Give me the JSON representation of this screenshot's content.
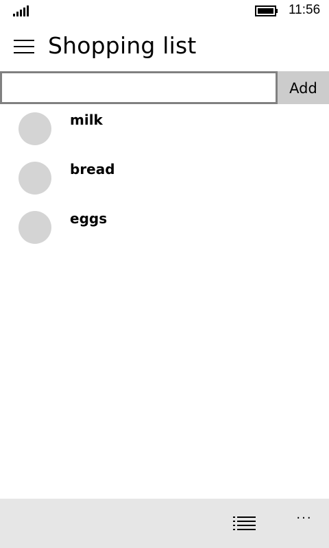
{
  "status_bar": {
    "time": "11:56",
    "signal_icon": "signal-strength-icon",
    "battery_icon": "battery-icon"
  },
  "header": {
    "menu_icon": "hamburger-menu-icon",
    "title": "Shopping list"
  },
  "new_item": {
    "value": "",
    "placeholder": "",
    "add_label": "Add"
  },
  "items": [
    {
      "label": "milk"
    },
    {
      "label": "bread"
    },
    {
      "label": "eggs"
    }
  ],
  "app_bar": {
    "list_icon": "list-view-icon",
    "more_label": "···"
  },
  "colors": {
    "background": "#ffffff",
    "input_border": "#808080",
    "add_button": "#cccccc",
    "avatar": "#d4d4d4",
    "app_bar": "#e6e6e6"
  }
}
